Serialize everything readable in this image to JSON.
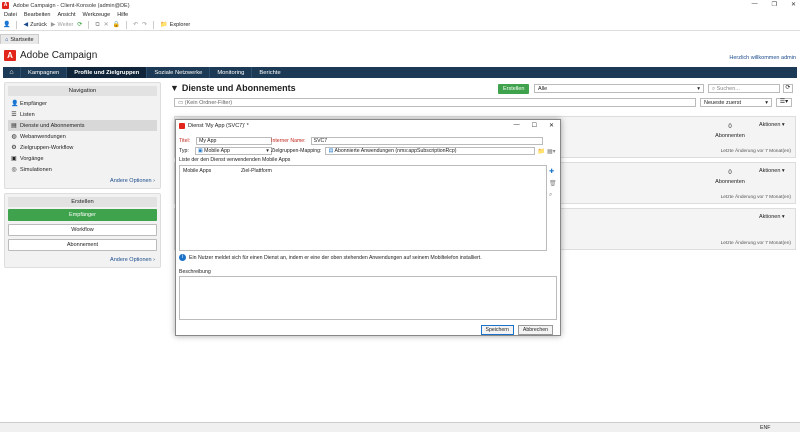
{
  "window": {
    "title": "Adobe Campaign - Client-Konsole (admin@DE)",
    "min": "—",
    "restore": "❐",
    "close": "✕"
  },
  "menu": [
    "Datei",
    "Bearbeiten",
    "Ansicht",
    "Werkzeuge",
    "Hilfe"
  ],
  "toolbar": {
    "back": "Zurück",
    "forward": "Weiter",
    "explorer": "Explorer"
  },
  "tabs": {
    "home": "Startseite"
  },
  "brand": {
    "name": "Adobe Campaign",
    "welcome": "Herzlich willkommen admin"
  },
  "nav": [
    "Kampagnen",
    "Profile und Zielgruppen",
    "Soziale Netzwerke",
    "Monitoring",
    "Berichte"
  ],
  "left": {
    "navigation_header": "Navigation",
    "items": [
      "Empfänger",
      "Listen",
      "Dienste und Abonnements",
      "Webanwendungen",
      "Zielgruppen-Workflow",
      "Vorgänge",
      "Simulationen"
    ],
    "more1": "Andere Optionen",
    "create_header": "Erstellen",
    "create_items": [
      "Empfänger",
      "Workflow",
      "Abonnement"
    ],
    "more2": "Andere Optionen"
  },
  "main": {
    "title": "Dienste und Abonnements",
    "create": "Erstellen",
    "filter_select": "Alle",
    "search_placeholder": "Suchen...",
    "folder_filter": "(Kein Ordner-Filter)",
    "sort": "Neueste zuerst",
    "cards": [
      {
        "count": "0",
        "label": "Abonnenten",
        "actions": "Aktionen",
        "last_change": "Letzte Änderung vor 7 Monat(en)"
      },
      {
        "count": "0",
        "label": "Abonnenten",
        "actions": "Aktionen",
        "last_change": "Letzte Änderung vor 7 Monat(en)"
      },
      {
        "count": "",
        "label": "",
        "actions": "Aktionen",
        "last_change": "Letzte Änderung vor 7 Monat(en)"
      }
    ]
  },
  "dialog": {
    "title": "Dienst 'My App (SVC7)' *",
    "title_label": "Titel:",
    "title_value": "My App",
    "internal_label": "Interner Name:",
    "internal_value": "SVC7",
    "type_label": "Typ:",
    "type_value": "Mobile App",
    "mapping_label": "Zielgruppen-Mapping:",
    "mapping_value": "Abonnierte Anwendungen (nms:appSubscriptionRcp)",
    "list_label": "Liste der den Dienst verwendenden Mobile Apps",
    "col1": "Mobile Apps",
    "col2": "Ziel-Plattform",
    "info": "Ein Nutzer meldet sich für einen Dienst an, indem er eine der oben stehenden Anwendungen auf seinem Mobiltelefon installiert.",
    "desc_label": "Beschreibung",
    "save": "Speichern",
    "cancel": "Abbrechen"
  },
  "status": {
    "lang": "ENF"
  }
}
